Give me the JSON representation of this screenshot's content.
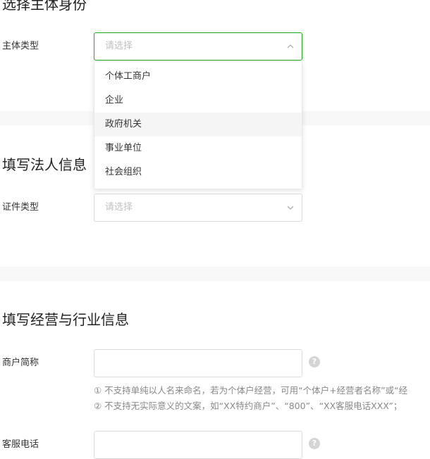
{
  "subject_section": {
    "title": "选择主体身份",
    "type_label": "主体类型",
    "type_placeholder": "请选择",
    "options": [
      "个体工商户",
      "企业",
      "政府机关",
      "事业单位",
      "社会组织"
    ]
  },
  "legal_section": {
    "title": "填写法人信息",
    "id_type_label": "证件类型",
    "id_type_placeholder": "请选择"
  },
  "business_section": {
    "title": "填写经营与行业信息",
    "merchant_name_label": "商户简称",
    "merchant_name_value": "",
    "help_glyph": "?",
    "notes": [
      "① 不支持单纯以人名来命名，若为个体户经营，可用“个体户+经营者名称”或“经",
      "② 不支持无实际意义的文案，如“XX特约商户”、“800”、“XX客服电话XXX”；"
    ],
    "phone_label": "客服电话",
    "phone_value": ""
  },
  "colors": {
    "accent_border": "#1aad19",
    "band_bg": "#f8f8f8",
    "hover_bg": "#f5f5f5"
  }
}
